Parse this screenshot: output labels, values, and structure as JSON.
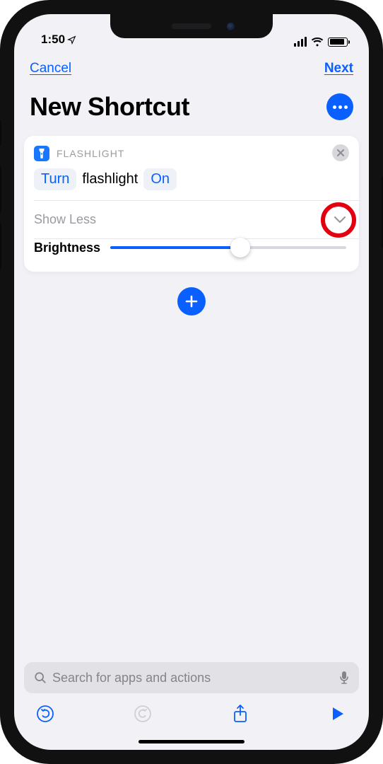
{
  "statusbar": {
    "time": "1:50"
  },
  "nav": {
    "cancel": "Cancel",
    "next": "Next"
  },
  "title": "New Shortcut",
  "action_card": {
    "app_label": "FLASHLIGHT",
    "tokens": {
      "verb": "Turn",
      "object": "flashlight",
      "state": "On"
    },
    "show_less_label": "Show Less",
    "brightness": {
      "label": "Brightness",
      "value": 0.55
    }
  },
  "search": {
    "placeholder": "Search for apps and actions"
  },
  "colors": {
    "accent": "#0a60ff",
    "annotation": "#e3000f"
  }
}
